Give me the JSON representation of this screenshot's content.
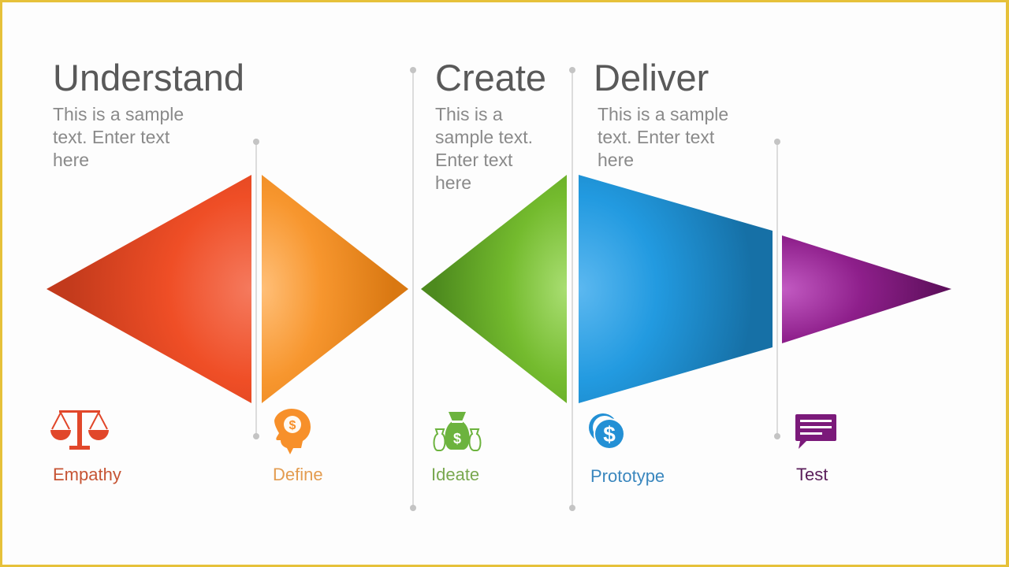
{
  "sections": [
    {
      "title": "Understand",
      "text_lines": [
        "This is a sample",
        "text. Enter text",
        "here"
      ]
    },
    {
      "title": "Create",
      "text_lines": [
        "This is a",
        "sample text.",
        "Enter text",
        "here"
      ]
    },
    {
      "title": "Deliver",
      "text_lines": [
        "This is a sample",
        "text. Enter text",
        "here"
      ]
    }
  ],
  "stages": [
    {
      "label": "Empathy",
      "icon": "scales-icon",
      "color": "#d9502a",
      "label_color": "#c65434"
    },
    {
      "label": "Define",
      "icon": "head-dollar-icon",
      "color": "#f5922a",
      "label_color": "#e39c50"
    },
    {
      "label": "Ideate",
      "icon": "money-bags-icon",
      "color": "#6cb33e",
      "label_color": "#79a84f"
    },
    {
      "label": "Prototype",
      "icon": "coins-dollar-icon",
      "color": "#1f8fd6",
      "label_color": "#3a87be"
    },
    {
      "label": "Test",
      "icon": "chat-bubble-icon",
      "color": "#7b1a7a",
      "label_color": "#5a1e5a"
    }
  ],
  "border_color": "#e6c13a"
}
